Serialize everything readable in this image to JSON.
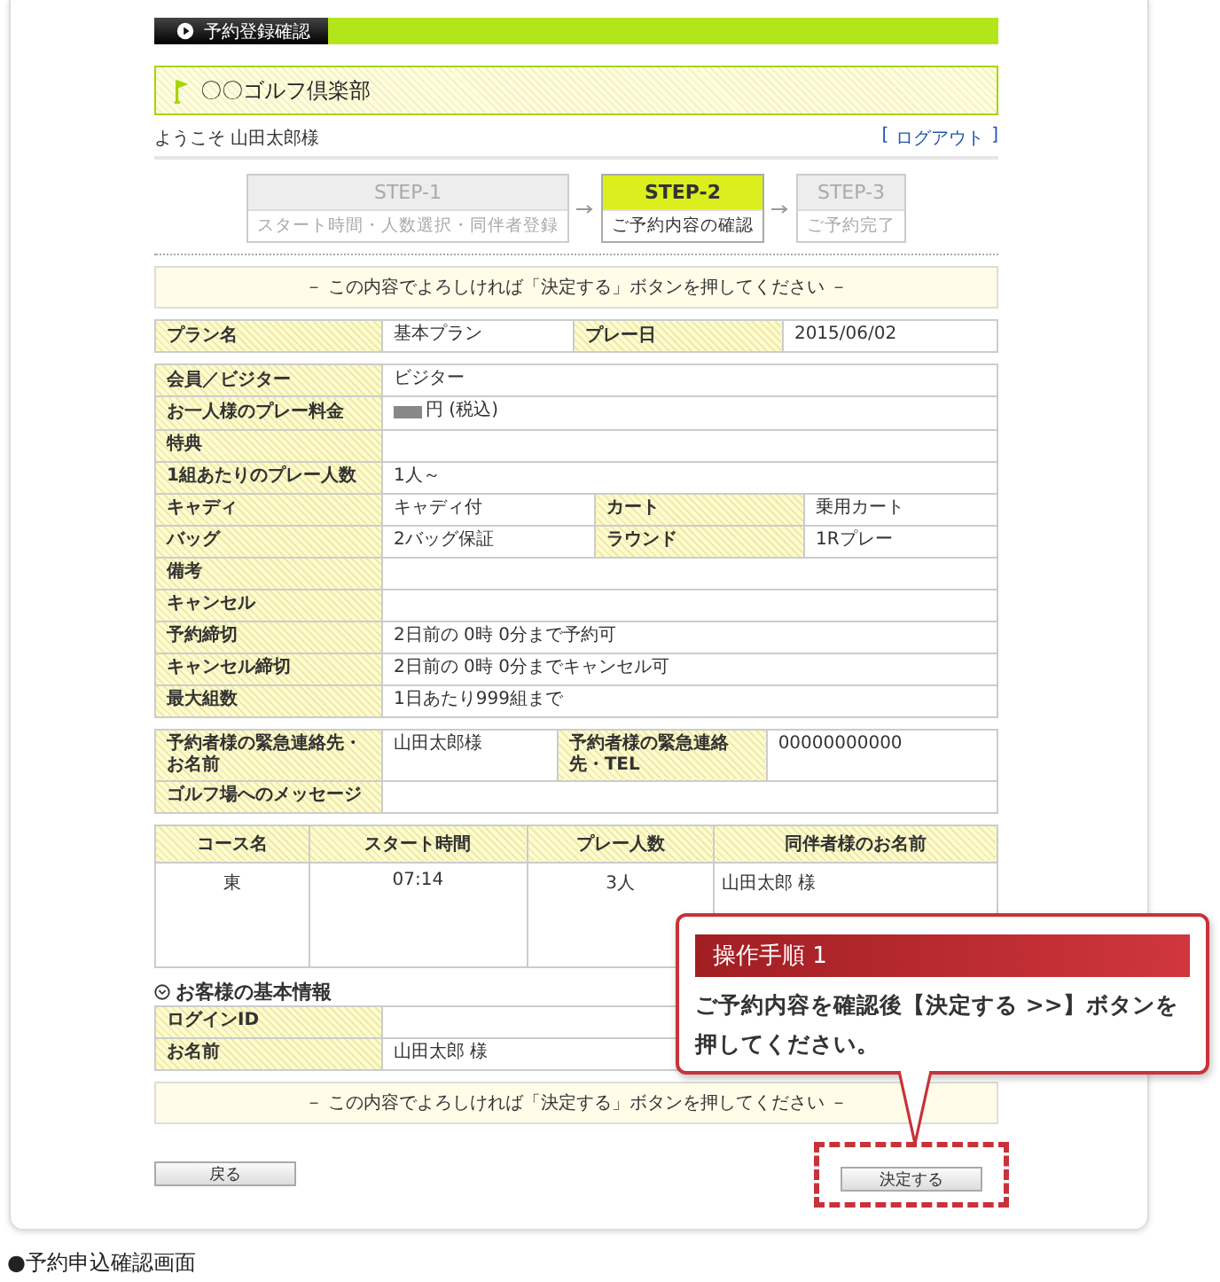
{
  "header": {
    "title": "予約登録確認"
  },
  "club": {
    "name": "〇〇ゴルフ倶楽部"
  },
  "welcome": "ようこそ 山田太郎様",
  "logout": {
    "open": "[",
    "label": "ログアウト",
    "close": "]"
  },
  "steps": [
    {
      "label": "STEP-1",
      "caption": "スタート時間・人数選択・同伴者登録",
      "selected": false
    },
    {
      "label": "STEP-2",
      "caption": "ご予約内容の確認",
      "selected": true
    },
    {
      "label": "STEP-3",
      "caption": "ご予約完了",
      "selected": false
    }
  ],
  "notice_top": "－ この内容でよろしければ「決定する」ボタンを押してください －",
  "plan_table": [
    {
      "cells": [
        {
          "label": "プラン名",
          "value": "基本プラン"
        },
        {
          "label": "プレー日",
          "value": "2015/06/02"
        }
      ]
    }
  ],
  "details_table": [
    {
      "cells": [
        {
          "label": "会員／ビジター",
          "value": "ビジター"
        }
      ]
    },
    {
      "cells": [
        {
          "label": "お一人様のプレー料金",
          "value": "円 (税込)",
          "masked": true
        }
      ]
    },
    {
      "cells": [
        {
          "label": "特典"
        }
      ]
    },
    {
      "cells": [
        {
          "label": "1組あたりのプレー人数",
          "value": "1人～"
        }
      ]
    },
    {
      "cells": [
        {
          "label": "キャディ",
          "value": "キャディ付"
        },
        {
          "label": "カート",
          "value": "乗用カート"
        }
      ]
    },
    {
      "cells": [
        {
          "label": "バッグ",
          "value": "2バッグ保証"
        },
        {
          "label": "ラウンド",
          "value": "1Rプレー"
        }
      ]
    },
    {
      "cells": [
        {
          "label": "備考"
        }
      ]
    },
    {
      "cells": [
        {
          "label": "キャンセル"
        }
      ]
    },
    {
      "cells": [
        {
          "label": "予約締切",
          "value": "2日前の 0時 0分まで予約可"
        }
      ]
    },
    {
      "cells": [
        {
          "label": "キャンセル締切",
          "value": "2日前の 0時 0分までキャンセル可"
        }
      ]
    },
    {
      "cells": [
        {
          "label": "最大組数",
          "value": "1日あたり999組まで"
        }
      ]
    }
  ],
  "contact_table": [
    {
      "cells": [
        {
          "label": "予約者様の緊急連絡先・お名前",
          "value": "山田太郎様"
        },
        {
          "label": "予約者様の緊急連絡先・TEL",
          "value": "00000000000"
        }
      ]
    },
    {
      "cells": [
        {
          "label": "ゴルフ場へのメッセージ"
        }
      ]
    }
  ],
  "course_table": {
    "columns": [
      "コース名",
      "スタート時間",
      "プレー人数",
      "同伴者様のお名前"
    ],
    "rows": [
      [
        "東",
        "07:14",
        "3人",
        "山田太郎 様"
      ]
    ]
  },
  "basic_info": {
    "title": "お客様の基本情報",
    "rows": [
      {
        "cells": [
          {
            "label": "ログインID"
          }
        ]
      },
      {
        "cells": [
          {
            "label": "お名前",
            "value": "山田太郎 様"
          }
        ]
      }
    ]
  },
  "notice_bottom": "－ この内容でよろしければ「決定する」ボタンを押してください －",
  "buttons": {
    "back": "戻る",
    "submit": "決定する"
  },
  "callout": {
    "title": "操作手順 1",
    "text": "ご予約内容を確認後【決定する >>】ボタンを押してください。"
  },
  "caption": "●予約申込確認画面"
}
